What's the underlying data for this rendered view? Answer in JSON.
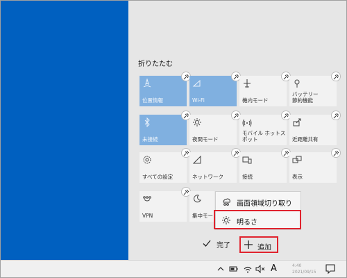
{
  "panel": {
    "collapse_label": "折りたたむ"
  },
  "tiles": [
    {
      "label": "位置情報",
      "icon": "location-icon",
      "active": true
    },
    {
      "label": "Wi-Fi",
      "icon": "wifi-icon",
      "active": true
    },
    {
      "label": "機内モード",
      "icon": "airplane-icon",
      "active": false
    },
    {
      "label": "バッテリー\n節約機能",
      "icon": "battery-saver-icon",
      "active": false
    },
    {
      "label": "未接続",
      "icon": "bluetooth-icon",
      "active": true
    },
    {
      "label": "夜間モード",
      "icon": "night-light-icon",
      "active": false
    },
    {
      "label": "モバイル ホットス\nポット",
      "icon": "hotspot-icon",
      "active": false
    },
    {
      "label": "近距離共有",
      "icon": "nearby-share-icon",
      "active": false
    },
    {
      "label": "すべての設定",
      "icon": "settings-icon",
      "active": false
    },
    {
      "label": "ネットワーク",
      "icon": "network-icon",
      "active": false
    },
    {
      "label": "接続",
      "icon": "connect-icon",
      "active": false
    },
    {
      "label": "表示",
      "icon": "project-icon",
      "active": false
    },
    {
      "label": "VPN",
      "icon": "vpn-icon",
      "active": false
    },
    {
      "label": "集中モー",
      "icon": "focus-assist-icon",
      "active": false
    }
  ],
  "context_menu": [
    {
      "label": "画面領域切り取り",
      "icon": "screen-snip-icon"
    },
    {
      "label": "明るさ",
      "icon": "brightness-icon"
    }
  ],
  "actions": {
    "done_label": "完了",
    "add_label": "追加"
  },
  "taskbar": {
    "ime_label": "A",
    "tray_icons": [
      "chevron-up-icon",
      "battery-icon",
      "wifi-icon",
      "mute-volume-icon"
    ],
    "clock_time": "4:40",
    "clock_date": "2021/09/15"
  },
  "colors": {
    "desktop": "#0060c0",
    "tile_on": "#80b0e0",
    "highlight": "#e0232e"
  }
}
